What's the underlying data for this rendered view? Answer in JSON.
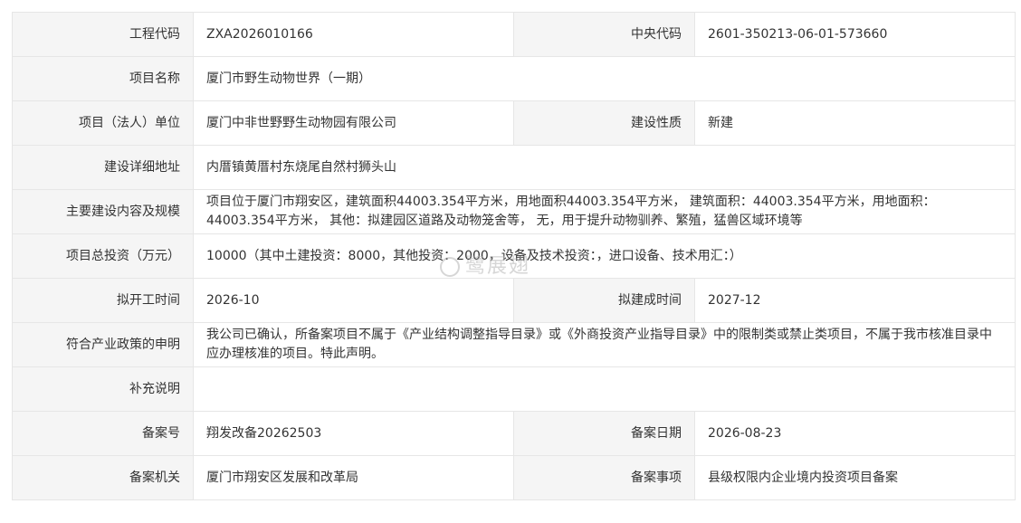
{
  "rows": [
    {
      "l1": "工程代码",
      "v1": "ZXA2026010166",
      "l2": "中央代码",
      "v2": "2601-350213-06-01-573660"
    },
    {
      "l1": "项目名称",
      "v1": "厦门市野生动物世界（一期）"
    },
    {
      "l1": "项目（法人）单位",
      "v1": "厦门中非世野野生动物园有限公司",
      "l2": "建设性质",
      "v2": "新建"
    },
    {
      "l1": "建设详细地址",
      "v1": "内厝镇黄厝村东烧尾自然村狮头山"
    },
    {
      "l1": "主要建设内容及规模",
      "v1": "项目位于厦门市翔安区，建筑面积44003.354平方米，用地面积44003.354平方米， 建筑面积：44003.354平方米，用地面积：44003.354平方米， 其他：拟建园区道路及动物笼舍等， 无，用于提升动物驯养、繁殖，猛兽区域环境等"
    },
    {
      "l1": "项目总投资（万元）",
      "v1": "10000（其中土建投资：8000，其他投资：2000，设备及技术投资：，进口设备、技术用汇：）"
    },
    {
      "l1": "拟开工时间",
      "v1": "2026-10",
      "l2": "拟建成时间",
      "v2": "2027-12"
    },
    {
      "l1": "符合产业政策的申明",
      "v1": "我公司已确认，所备案项目不属于《产业结构调整指导目录》或《外商投资产业指导目录》中的限制类或禁止类项目，不属于我市核准目录中应办理核准的项目。特此声明。"
    },
    {
      "l1": "补充说明",
      "v1": ""
    },
    {
      "l1": "备案号",
      "v1": "翔发改备20262503",
      "l2": "备案日期",
      "v2": "2026-08-23"
    },
    {
      "l1": "备案机关",
      "v1": "厦门市翔安区发展和改革局",
      "l2": "备案事项",
      "v2": "县级权限内企业境内投资项目备案"
    }
  ],
  "watermark": {
    "text": "鹭展翅"
  }
}
